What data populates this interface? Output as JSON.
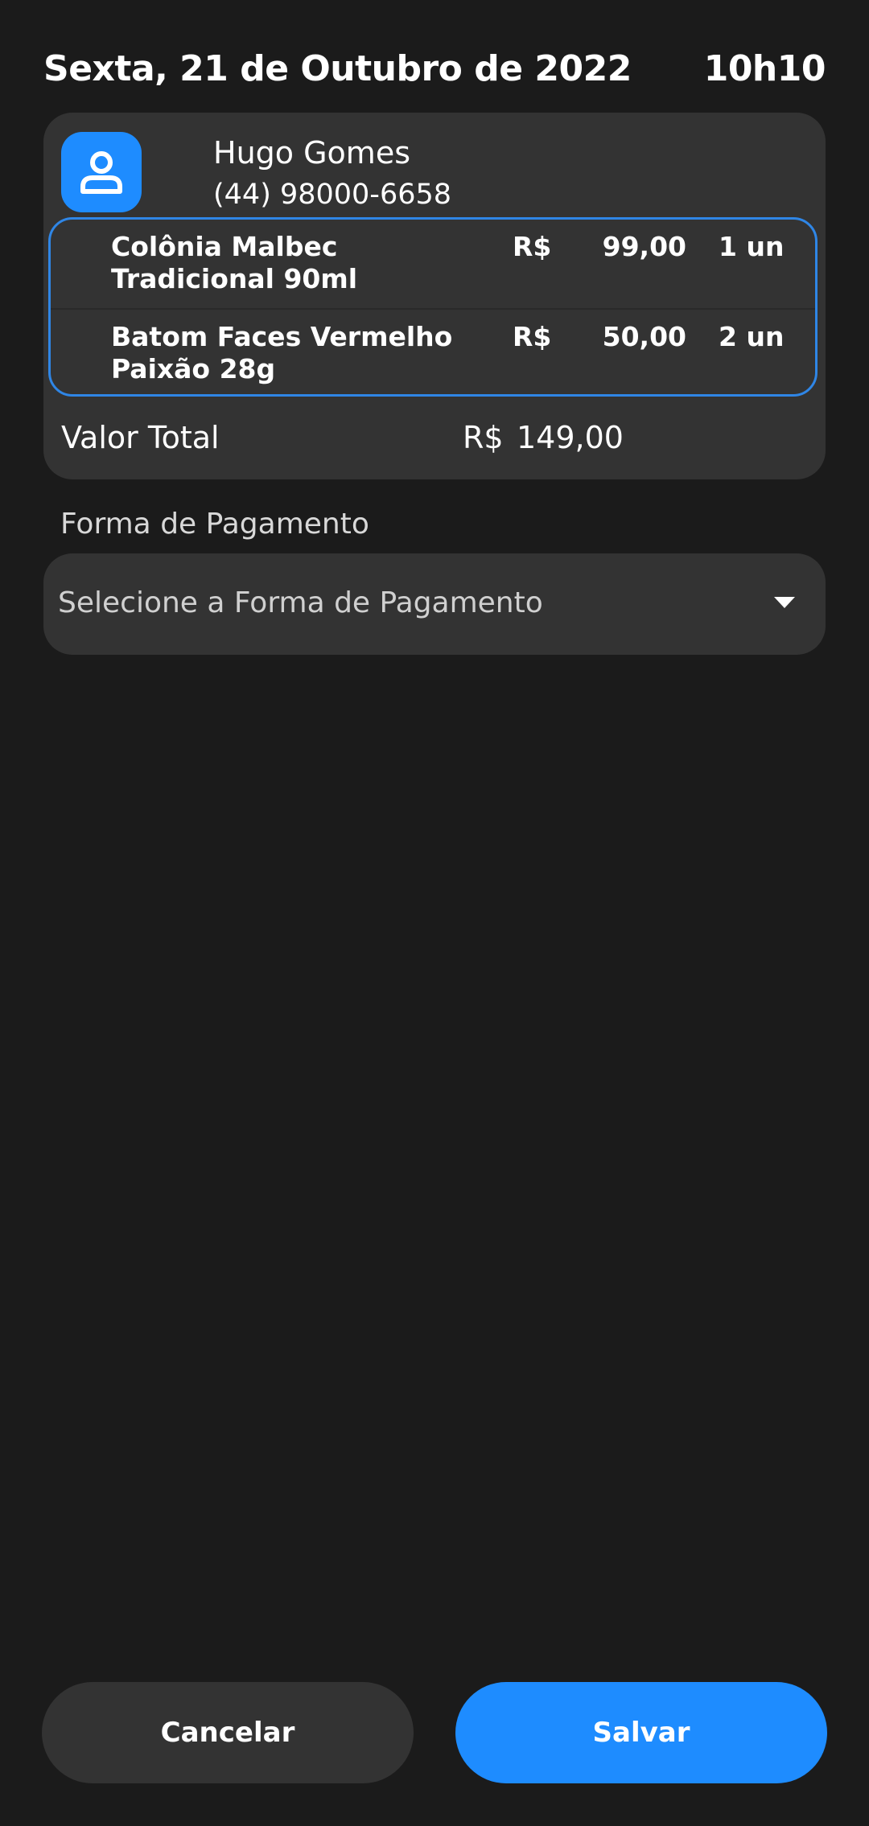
{
  "header": {
    "date": "Sexta, 21 de Outubro de 2022",
    "time": "10h10"
  },
  "customer": {
    "icon": "user-icon",
    "name": "Hugo Gomes",
    "phone": "(44) 98000-6658"
  },
  "items": [
    {
      "name": "Colônia Malbec Tradicional 90ml",
      "currency": "R$",
      "price": "99,00",
      "quantity": "1 un"
    },
    {
      "name": "Batom Faces Vermelho Paixão 28g",
      "currency": "R$",
      "price": "50,00",
      "quantity": "2 un"
    }
  ],
  "total": {
    "label": "Valor Total",
    "currency": "R$",
    "value": "149,00"
  },
  "payment": {
    "label": "Forma de Pagamento",
    "placeholder": "Selecione a Forma de Pagamento",
    "icon": "chevron-down-icon"
  },
  "actions": {
    "cancel_label": "Cancelar",
    "save_label": "Salvar"
  },
  "colors": {
    "background": "#1b1b1b",
    "card": "#333333",
    "accent": "#1e8cff",
    "items_border": "#2f86e6"
  }
}
